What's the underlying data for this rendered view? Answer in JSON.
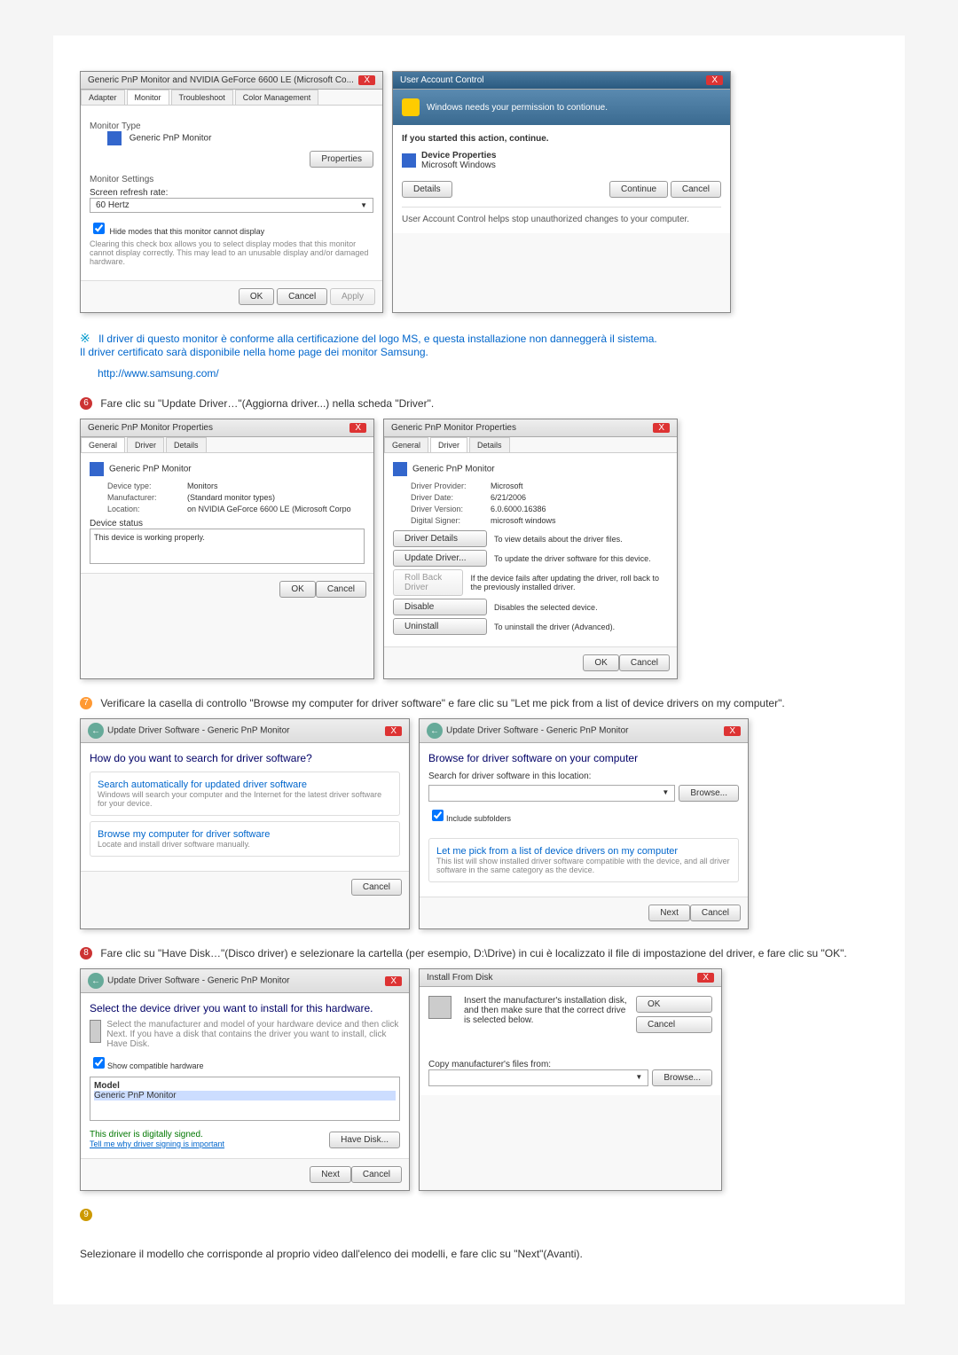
{
  "monitor_dialog": {
    "title": "Generic PnP Monitor and NVIDIA GeForce 6600 LE (Microsoft Co...",
    "tabs": [
      "Adapter",
      "Monitor",
      "Troubleshoot",
      "Color Management"
    ],
    "monitor_type_label": "Monitor Type",
    "monitor_name": "Generic PnP Monitor",
    "properties_btn": "Properties",
    "settings_label": "Monitor Settings",
    "refresh_label": "Screen refresh rate:",
    "refresh_value": "60 Hertz",
    "hide_modes_checkbox": "Hide modes that this monitor cannot display",
    "hide_modes_desc": "Clearing this check box allows you to select display modes that this monitor cannot display correctly. This may lead to an unusable display and/or damaged hardware.",
    "ok": "OK",
    "cancel": "Cancel",
    "apply": "Apply"
  },
  "uac": {
    "title": "User Account Control",
    "heading": "Windows needs your permission to contionue.",
    "started": "If you started this action, continue.",
    "prop_label": "Device Properties",
    "prop_vendor": "Microsoft Windows",
    "details": "Details",
    "continue": "Continue",
    "cancel": "Cancel",
    "footer": "User Account Control helps stop unauthorized changes to your computer."
  },
  "note": {
    "line1": "Il driver di questo monitor è conforme alla certificazione del logo MS, e questa installazione non danneggerà il sistema.",
    "line2": "Il driver certificato sarà disponibile nella home page dei monitor Samsung.",
    "url": "http://www.samsung.com/"
  },
  "step6": {
    "text": "Fare clic su \"Update Driver…\"(Aggiorna driver...) nella scheda \"Driver\".",
    "dlg1_title": "Generic PnP Monitor Properties",
    "tabs1": [
      "General",
      "Driver",
      "Details"
    ],
    "device_label": "Generic PnP Monitor",
    "rows1": [
      {
        "k": "Device type:",
        "v": "Monitors"
      },
      {
        "k": "Manufacturer:",
        "v": "(Standard monitor types)"
      },
      {
        "k": "Location:",
        "v": "on NVIDIA GeForce 6600 LE (Microsoft Corpo"
      }
    ],
    "status_label": "Device status",
    "status_text": "This device is working properly.",
    "rows2": [
      {
        "k": "Driver Provider:",
        "v": "Microsoft"
      },
      {
        "k": "Driver Date:",
        "v": "6/21/2006"
      },
      {
        "k": "Driver Version:",
        "v": "6.0.6000.16386"
      },
      {
        "k": "Digital Signer:",
        "v": "microsoft windows"
      }
    ],
    "btn_details": "Driver Details",
    "btn_details_desc": "To view details about the driver files.",
    "btn_update": "Update Driver...",
    "btn_update_desc": "To update the driver software for this device.",
    "btn_rollback": "Roll Back Driver",
    "btn_rollback_desc": "If the device fails after updating the driver, roll back to the previously installed driver.",
    "btn_disable": "Disable",
    "btn_disable_desc": "Disables the selected device.",
    "btn_uninstall": "Uninstall",
    "btn_uninstall_desc": "To uninstall the driver (Advanced).",
    "ok": "OK",
    "cancel": "Cancel"
  },
  "step7": {
    "text": "Verificare la casella di controllo \"Browse my computer for driver software\" e fare clic su \"Let me pick from a list of device drivers on my computer\".",
    "dlg_title": "Update Driver Software - Generic PnP Monitor",
    "q": "How do you want to search for driver software?",
    "opt1_title": "Search automatically for updated driver software",
    "opt1_desc": "Windows will search your computer and the Internet for the latest driver software for your device.",
    "opt2_title": "Browse my computer for driver software",
    "opt2_desc": "Locate and install driver software manually.",
    "browse_heading": "Browse for driver software on your computer",
    "search_label": "Search for driver software in this location:",
    "browse_btn": "Browse...",
    "include_sub": "Include subfolders",
    "pick_title": "Let me pick from a list of device drivers on my computer",
    "pick_desc": "This list will show installed driver software compatible with the device, and all driver software in the same category as the device.",
    "next": "Next",
    "cancel": "Cancel"
  },
  "step8": {
    "text": "Fare clic su \"Have Disk…\"(Disco driver) e selezionare la cartella (per esempio, D:\\Drive) in cui è localizzato il file di impostazione del driver, e fare clic su \"OK\".",
    "dlg_title": "Update Driver Software - Generic PnP Monitor",
    "select_heading": "Select the device driver you want to install for this hardware.",
    "select_desc": "Select the manufacturer and model of your hardware device and then click Next. If you have a disk that contains the driver you want to install, click Have Disk.",
    "show_compat": "Show compatible hardware",
    "model_label": "Model",
    "model_item": "Generic PnP Monitor",
    "signed_label": "This driver is digitally signed.",
    "signed_link": "Tell me why driver signing is important",
    "have_disk": "Have Disk...",
    "next": "Next",
    "cancel": "Cancel",
    "disk_title": "Install From Disk",
    "disk_text": "Insert the manufacturer's installation disk, and then make sure that the correct drive is selected below.",
    "disk_copy": "Copy manufacturer's files from:",
    "ok": "OK",
    "browse": "Browse..."
  },
  "step9": {
    "text": "Selezionare il modello che corrisponde al proprio video dall'elenco dei modelli, e fare clic su \"Next\"(Avanti)."
  }
}
